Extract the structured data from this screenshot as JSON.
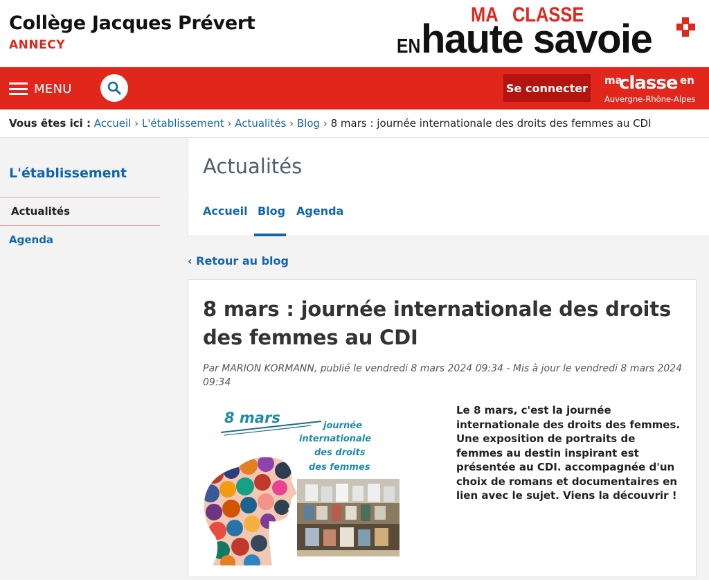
{
  "header": {
    "site_title": "Collège Jacques Prévert",
    "site_subtitle": "ANNECY",
    "logo": {
      "ma": "MA",
      "classe": "CLASSE",
      "en": "EN",
      "name": "haute savoie"
    }
  },
  "navbar": {
    "menu_label": "MENU",
    "connect_label": "Se connecter",
    "logo": {
      "ma": "ma",
      "classe": "classe",
      "en": "en",
      "region": "Auvergne-Rhône-Alpes"
    },
    "colors": {
      "bar": "#e1261c",
      "button": "#b3140f"
    }
  },
  "breadcrumb": {
    "prefix": "Vous êtes ici :",
    "items": [
      "Accueil",
      "L'établissement",
      "Actualités",
      "Blog"
    ],
    "separator": "›",
    "current": "8 mars : journée internationale des droits des femmes au CDI"
  },
  "sidebar": {
    "title": "L'établissement",
    "items": [
      {
        "label": "Actualités",
        "active": true
      },
      {
        "label": "Agenda",
        "active": false
      }
    ]
  },
  "section": {
    "title": "Actualités",
    "tabs": [
      {
        "label": "Accueil",
        "active": false
      },
      {
        "label": "Blog",
        "active": true
      },
      {
        "label": "Agenda",
        "active": false
      }
    ]
  },
  "back_link": "‹ Retour au blog",
  "article": {
    "title": "8 mars : journée internationale des droits des femmes au CDI",
    "meta": "Par MARION KORMANN, publié le vendredi 8 mars 2024 09:34 - Mis à jour le vendredi 8 mars 2024 09:34",
    "image": {
      "heading": "8 mars",
      "line1": "journée",
      "line2": "internationale",
      "line3": "des droits",
      "line4": "des femmes"
    },
    "body": "Le 8 mars, c'est la journée internationale des droits des femmes. Une exposition de portraits de femmes au destin inspirant est présentée au CDI. accompagnée d'un choix de romans et documentaires en lien avec le sujet. Viens la découvrir !"
  },
  "colors": {
    "link": "#1266ae",
    "accent": "#e1261c"
  }
}
